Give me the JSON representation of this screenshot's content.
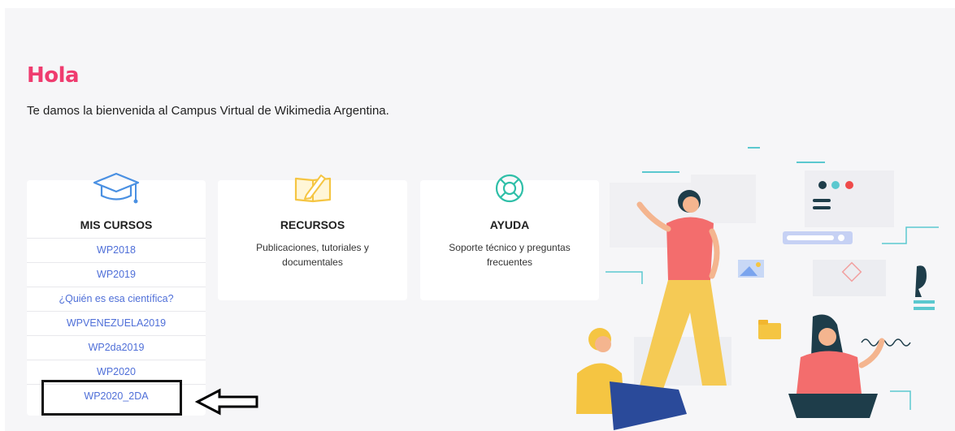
{
  "greeting": "Hola",
  "welcome": "Te damos la bienvenida al Campus Virtual de Wikimedia Argentina.",
  "cards": {
    "courses": {
      "title": "MIS CURSOS",
      "icon": "graduation-cap-icon",
      "items": [
        "WP2018",
        "WP2019",
        "¿Quién es esa científica?",
        "WPVENEZUELA2019",
        "WP2da2019",
        "WP2020",
        "WP2020_2DA"
      ]
    },
    "resources": {
      "title": "RECURSOS",
      "icon": "notebook-pencil-icon",
      "description": "Publicaciones, tutoriales y documentales"
    },
    "help": {
      "title": "AYUDA",
      "icon": "lifebuoy-icon",
      "description": "Soporte técnico y preguntas frecuentes"
    }
  },
  "colors": {
    "accent": "#ef3c6f",
    "link": "#4f6fd8",
    "icon_yellow": "#f5c542",
    "icon_blue": "#4a90e2",
    "icon_teal": "#2fbfa8"
  }
}
